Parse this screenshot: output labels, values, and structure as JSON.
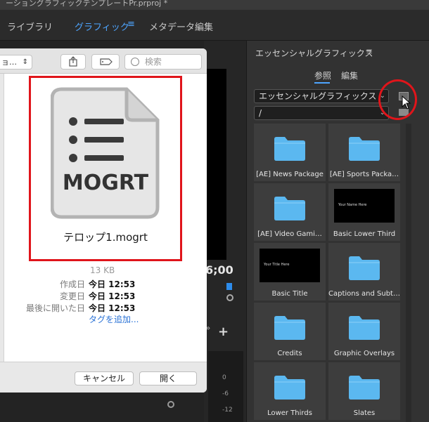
{
  "window": {
    "title": "ーショングラフィックテンプレートPr.prproj *"
  },
  "workspaces": {
    "library": "ライブラリ",
    "graphics": "グラフィック",
    "menu_glyph": "≡",
    "metadata": "メタデータ編集"
  },
  "program_monitor": {
    "timecode": "6;00",
    "audio_scale": [
      "0",
      "-6",
      "-12"
    ]
  },
  "dialog": {
    "path_popup": "ョ…",
    "search_placeholder": "検索",
    "preview": {
      "icon_text": "MOGRT",
      "file_name": "テロップ1.mogrt"
    },
    "info": {
      "size": "13 KB",
      "created_label": "作成日",
      "created_value": "今日 12:53",
      "modified_label": "変更日",
      "modified_value": "今日 12:53",
      "opened_label": "最後に開いた日",
      "opened_value": "今日 12:53",
      "add_tag": "タグを追加..."
    },
    "cancel_label": "キャンセル",
    "open_label": "開く"
  },
  "essential_graphics": {
    "title": "エッセンシャルグラフィックス",
    "menu_glyph": "≡",
    "tab_browse": "参照",
    "tab_edit": "編集",
    "source_select": "エッセンシャルグラフィックス",
    "path_select": "/",
    "items": [
      {
        "label": "[AE] News Package",
        "kind": "folder"
      },
      {
        "label": "[AE] Sports Packa…",
        "kind": "folder"
      },
      {
        "label": "[AE] Video Gami…",
        "kind": "folder"
      },
      {
        "label": "Basic Lower Third",
        "kind": "thumbnail",
        "thumb_text": "Your Name Here"
      },
      {
        "label": "Basic Title",
        "kind": "thumbnail",
        "thumb_text": "Your Title Here"
      },
      {
        "label": "Captions and Subt…",
        "kind": "folder"
      },
      {
        "label": "Credits",
        "kind": "folder"
      },
      {
        "label": "Graphic Overlays",
        "kind": "folder"
      },
      {
        "label": "Lower Thirds",
        "kind": "folder"
      },
      {
        "label": "Slates",
        "kind": "folder"
      }
    ]
  },
  "colors": {
    "accent_blue": "#4ea5ff",
    "highlight_red": "#e0151b",
    "folder_blue": "#5bb8f0"
  }
}
